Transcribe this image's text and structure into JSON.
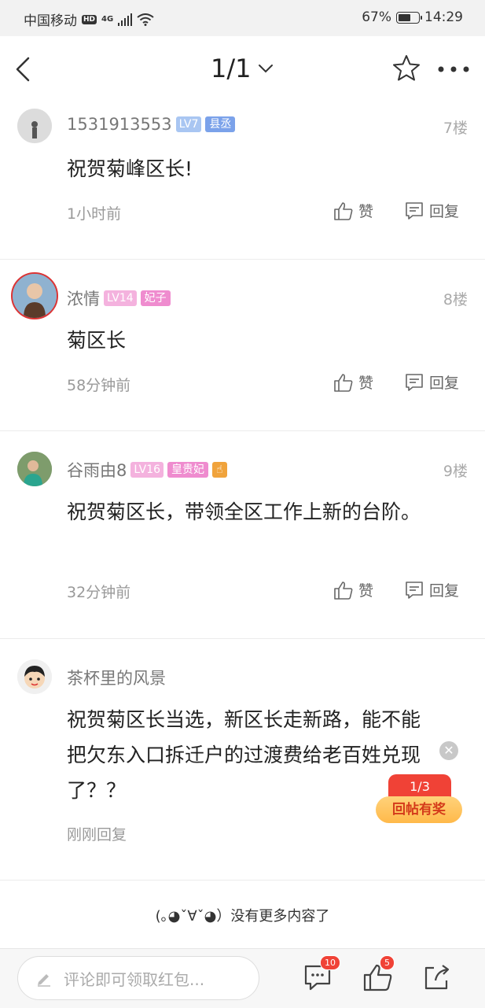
{
  "status_bar": {
    "carrier": "中国移动",
    "hd": "HD",
    "network": "4G",
    "battery_percent": "67%",
    "battery_level": 0.67,
    "time": "14:29"
  },
  "nav": {
    "page_indicator": "1/1"
  },
  "comments": [
    {
      "username": "1531913553",
      "level": "LV7",
      "title": "县丞",
      "floor": "7楼",
      "text": "祝贺菊峰区长!",
      "time": "1小时前",
      "like_label": "赞",
      "reply_label": "回复"
    },
    {
      "username": "浓情",
      "level": "LV14",
      "title": "妃子",
      "floor": "8楼",
      "text": "菊区长",
      "time": "58分钟前",
      "like_label": "赞",
      "reply_label": "回复"
    },
    {
      "username": "谷雨由8",
      "level": "LV16",
      "title": "皇贵妃",
      "floor": "9楼",
      "text": "祝贺菊区长，带领全区工作上新的台阶。",
      "time": "32分钟前",
      "like_label": "赞",
      "reply_label": "回复"
    },
    {
      "username": "茶杯里的风景",
      "text": "祝贺菊区长当选，新区长走新路，能不能把欠东入口拆迁户的过渡费给老百姓兑现了？？",
      "time": "刚刚回复"
    }
  ],
  "reward": {
    "counter": "1/3",
    "label": "回帖有奖"
  },
  "end_message": "(｡◕ˇ∀ˇ◕）没有更多内容了",
  "bottom_bar": {
    "placeholder": "评论即可领取红包...",
    "comment_badge": "10",
    "like_badge": "5"
  },
  "colors": {
    "lv_blue": "#a9c6f2",
    "title_blue": "#7ba2ea",
    "lv_pink": "#f4b2de",
    "title_pink": "#ef8ccf",
    "badge_orange": "#f0a33c",
    "accent_red": "#f04236"
  }
}
